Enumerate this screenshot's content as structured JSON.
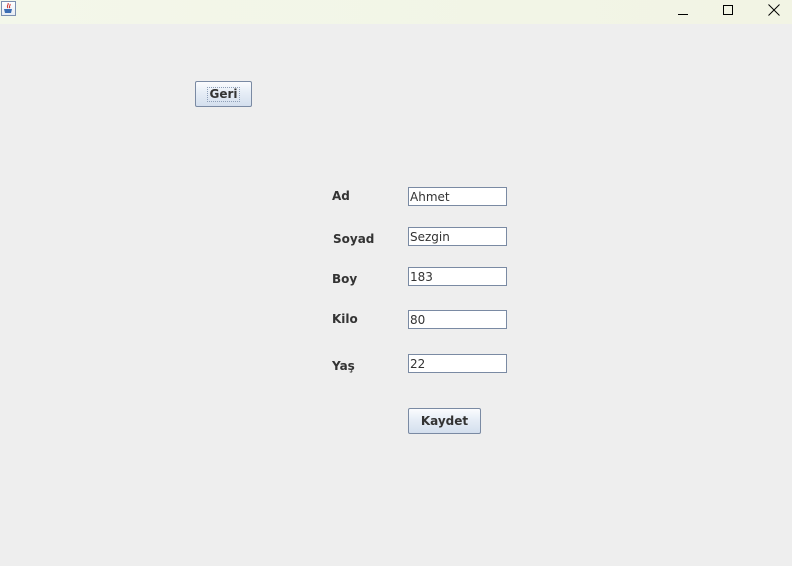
{
  "window": {
    "app_icon": "java-cup-icon",
    "controls": {
      "minimize": "minimize-icon",
      "maximize": "maximize-icon",
      "close": "close-icon"
    }
  },
  "buttons": {
    "back_label": "Geri",
    "save_label": "Kaydet"
  },
  "form": {
    "fields": {
      "ad": {
        "label": "Ad",
        "value": "Ahmet"
      },
      "soyad": {
        "label": "Soyad",
        "value": "Sezgin"
      },
      "boy": {
        "label": "Boy",
        "value": "183"
      },
      "kilo": {
        "label": "Kilo",
        "value": "80"
      },
      "yas": {
        "label": "Yaş",
        "value": "22"
      }
    }
  },
  "colors": {
    "background": "#eeeeee",
    "button_border": "#7a8aa3",
    "text": "#333333"
  }
}
